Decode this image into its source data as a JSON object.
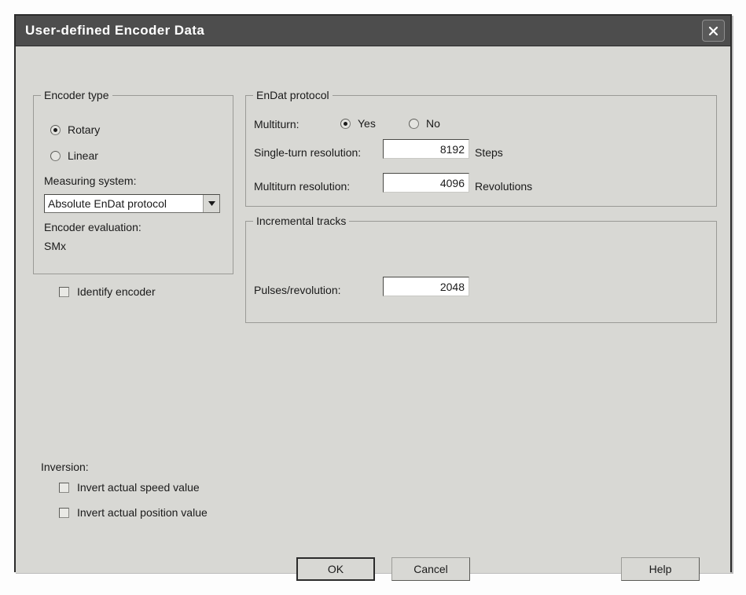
{
  "window": {
    "title": "User-defined Encoder Data",
    "close_icon": "close-icon"
  },
  "encoder_type": {
    "group_title": "Encoder type",
    "radios": [
      {
        "label": "Rotary",
        "checked": true
      },
      {
        "label": "Linear",
        "checked": false
      }
    ],
    "measuring_system_label": "Measuring system:",
    "measuring_system_value": "Absolute EnDat protocol",
    "measuring_system_arrow_icon": "chevron-down-icon",
    "encoder_evaluation_label": "Encoder evaluation:",
    "encoder_evaluation_value": "SMx"
  },
  "identify_encoder": {
    "label": "Identify encoder",
    "checked": false
  },
  "endat_protocol": {
    "group_title": "EnDat protocol",
    "multiturn_label": "Multiturn:",
    "multiturn_radios": [
      {
        "label": "Yes",
        "checked": true
      },
      {
        "label": "No",
        "checked": false
      }
    ],
    "single_turn_label": "Single-turn resolution:",
    "single_turn_value": "8192",
    "single_turn_unit": "Steps",
    "multiturn_res_label": "Multiturn resolution:",
    "multiturn_res_value": "4096",
    "multiturn_res_unit": "Revolutions"
  },
  "incremental_tracks": {
    "group_title": "Incremental tracks",
    "pulses_label": "Pulses/revolution:",
    "pulses_value": "2048"
  },
  "inversion": {
    "label": "Inversion:",
    "checkboxes": [
      {
        "label": "Invert actual speed value",
        "checked": false
      },
      {
        "label": "Invert actual position value",
        "checked": false
      }
    ]
  },
  "buttons": {
    "ok": "OK",
    "cancel": "Cancel",
    "help": "Help"
  },
  "colors": {
    "titlebar": "#4d4d4d",
    "dialog_face": "#d8d8d4",
    "field": "#ffffff",
    "text": "#1a1a1a"
  }
}
